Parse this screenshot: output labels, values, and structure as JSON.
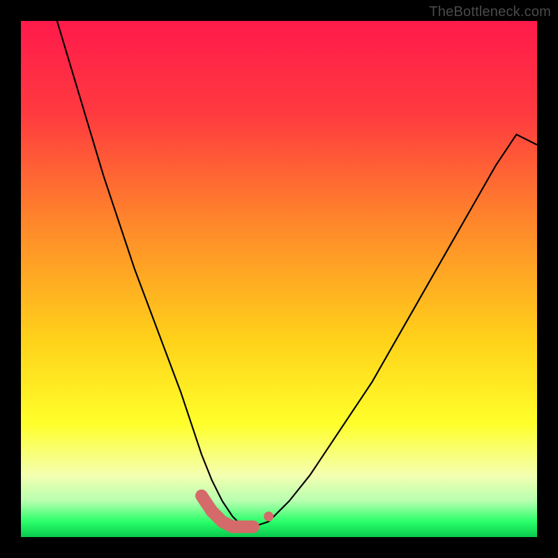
{
  "watermark": "TheBottleneck.com",
  "chart_data": {
    "type": "line",
    "title": "",
    "xlabel": "",
    "ylabel": "",
    "xlim": [
      0,
      100
    ],
    "ylim": [
      0,
      100
    ],
    "background_gradient_stops": [
      {
        "pos": 0,
        "color": "#ff1a4b"
      },
      {
        "pos": 18,
        "color": "#ff3a3f"
      },
      {
        "pos": 40,
        "color": "#ff8a2a"
      },
      {
        "pos": 62,
        "color": "#ffd21a"
      },
      {
        "pos": 78,
        "color": "#ffff2a"
      },
      {
        "pos": 88,
        "color": "#f4ffb0"
      },
      {
        "pos": 93,
        "color": "#b8ffb0"
      },
      {
        "pos": 97,
        "color": "#2aff6a"
      },
      {
        "pos": 100,
        "color": "#09c94e"
      }
    ],
    "series": [
      {
        "name": "bottleneck-curve",
        "x": [
          7,
          10,
          13,
          16,
          19,
          22,
          25,
          28,
          31,
          33,
          35,
          37,
          39,
          41,
          43,
          45,
          48,
          52,
          56,
          60,
          64,
          68,
          72,
          76,
          80,
          84,
          88,
          92,
          96,
          100
        ],
        "y": [
          100,
          90,
          80,
          70,
          61,
          52,
          44,
          36,
          28,
          22,
          16,
          11,
          7,
          4,
          2,
          2,
          3,
          7,
          12,
          18,
          24,
          30,
          37,
          44,
          51,
          58,
          65,
          72,
          78,
          76
        ],
        "note": "y=0 is bottom (green), y=100 is top (red); values visually estimated"
      }
    ],
    "highlighted_points": {
      "name": "optimal-region-markers",
      "color": "#d46a6a",
      "x": [
        35,
        37,
        39,
        41,
        43,
        45,
        48
      ],
      "y": [
        8,
        5,
        3,
        2,
        2,
        2,
        4
      ]
    }
  }
}
